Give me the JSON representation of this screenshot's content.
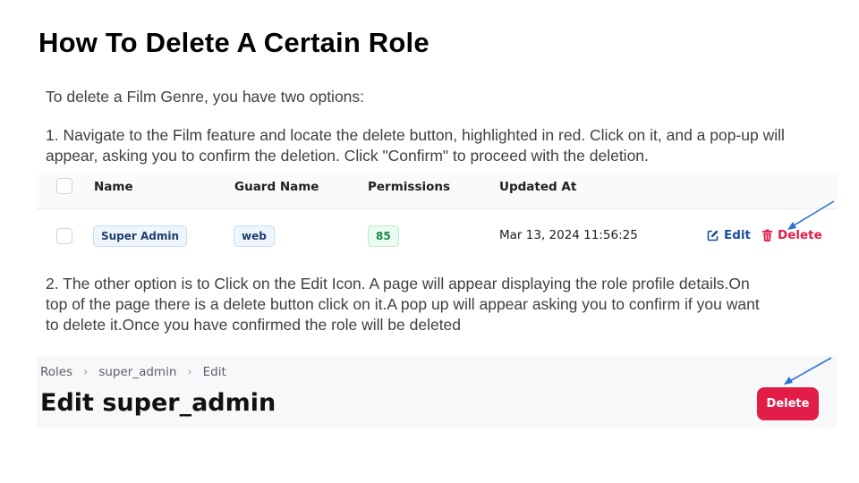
{
  "title": "How To Delete A Certain Role",
  "intro": "To delete a Film Genre, you have two options:",
  "step1": "1. Navigate to the Film feature and locate the delete button, highlighted in red. Click on it, and a pop-up will appear, asking you to confirm the deletion. Click \"Confirm\" to proceed with the deletion.",
  "step2": "2. The other option is to Click on the Edit Icon. A page will appear displaying the role profile details.On top of the page there is a delete button click on it.A pop up will appear asking you to confirm if you want to delete it.Once you have confirmed the role will be deleted",
  "table": {
    "headers": {
      "name": "Name",
      "guard_name": "Guard Name",
      "permissions": "Permissions",
      "updated_at": "Updated At"
    },
    "row": {
      "name": "Super Admin",
      "guard_name": "web",
      "permissions": "85",
      "updated_at": "Mar 13, 2024 11:56:25",
      "edit_label": "Edit",
      "delete_label": "Delete"
    }
  },
  "edit_page": {
    "breadcrumbs": [
      "Roles",
      "super_admin",
      "Edit"
    ],
    "heading": "Edit super_admin",
    "delete_label": "Delete"
  },
  "colors": {
    "danger": "#e11d48",
    "edit_link": "#1d4e9a",
    "arrow": "#2f6fd6"
  },
  "icons": {
    "edit": "pencil-square-icon",
    "delete": "trash-icon",
    "breadcrumb_separator": "chevron-right-icon",
    "annotation": "arrow-icon"
  }
}
